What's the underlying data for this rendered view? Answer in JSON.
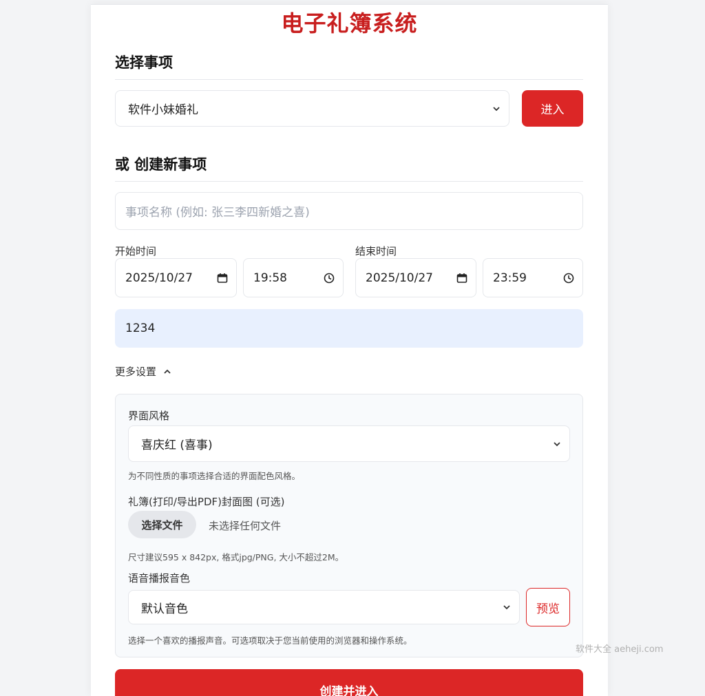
{
  "app": {
    "title": "电子礼簿系统"
  },
  "select_event": {
    "heading": "选择事项",
    "selected": "软件小妹婚礼",
    "enter_label": "进入"
  },
  "create_event": {
    "heading": "或 创建新事项",
    "name_placeholder": "事项名称 (例如: 张三李四新婚之喜)",
    "start_label": "开始时间",
    "start_date": "2025/10/27",
    "start_time": "19:58",
    "end_label": "结束时间",
    "end_date": "2025/10/27",
    "end_time": "23:59",
    "password_value": "1234",
    "more_settings_label": "更多设置",
    "submit_label": "创建并进入"
  },
  "more_settings": {
    "theme_label": "界面风格",
    "theme_selected": "喜庆红 (喜事)",
    "theme_hint": "为不同性质的事项选择合适的界面配色风格。",
    "cover_label": "礼簿(打印/导出PDF)封面图 (可选)",
    "choose_file_label": "选择文件",
    "no_file_text": "未选择任何文件",
    "cover_hint": "尺寸建议595 x 842px, 格式jpg/PNG, 大小不超过2M。",
    "voice_label": "语音播报音色",
    "voice_selected": "默认音色",
    "preview_label": "预览",
    "voice_hint": "选择一个喜欢的播报声音。可选项取决于您当前使用的浏览器和操作系统。"
  },
  "watermark": "软件大全 aeheji.com",
  "colors": {
    "accent": "#dc2626",
    "title": "#c81e1e",
    "password_bg": "#e8f0fe",
    "page_bg": "#f3f4f6"
  },
  "icons": [
    "chevron-down-icon",
    "calendar-icon",
    "clock-icon",
    "chevron-up-icon"
  ]
}
